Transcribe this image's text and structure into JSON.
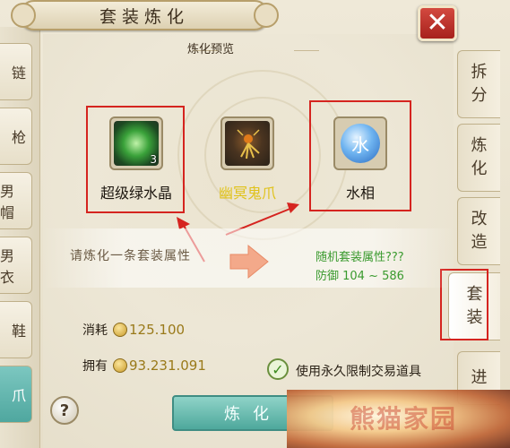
{
  "header": {
    "title": "套装炼化"
  },
  "close_button": {
    "label": "✕"
  },
  "left_tabs": [
    {
      "label": "链"
    },
    {
      "label": "枪"
    },
    {
      "label": "男帽"
    },
    {
      "label": "男衣"
    },
    {
      "label": "鞋"
    },
    {
      "label": "爪"
    }
  ],
  "right_tabs": [
    {
      "line1": "拆",
      "line2": "分"
    },
    {
      "line1": "炼",
      "line2": "化"
    },
    {
      "line1": "改",
      "line2": "造"
    },
    {
      "line1": "套",
      "line2": "装"
    },
    {
      "line1": "进",
      "line2": ""
    }
  ],
  "preview": {
    "label": "炼化预览"
  },
  "items": [
    {
      "name": "超级绿水晶",
      "count": "3",
      "name_color": "#1d1710",
      "icon": "green-crystal-icon"
    },
    {
      "name": "幽冥鬼爪",
      "count": "",
      "name_color": "#e0c21a",
      "icon": "ghost-claw-icon"
    },
    {
      "name": "水相",
      "count": "",
      "name_color": "#1d1710",
      "icon": "water-orb-icon"
    }
  ],
  "refine": {
    "prompt": "请炼化一条套装属性",
    "result_line1": "随机套装属性???",
    "result_line2": "防御 104 ~ 586"
  },
  "cost": {
    "label": "消耗",
    "value": "125.100"
  },
  "owned": {
    "label": "拥有",
    "value": "93.231.091"
  },
  "option": {
    "label": "使用永久限制交易道具",
    "checked": true
  },
  "help_button": {
    "label": "?"
  },
  "refine_button": {
    "label": "炼化"
  },
  "watermark": {
    "text": "熊猫家园"
  },
  "colors": {
    "accent_teal": "#4ea89c",
    "highlight_red": "#d5241f",
    "close_red": "#a7211c"
  }
}
